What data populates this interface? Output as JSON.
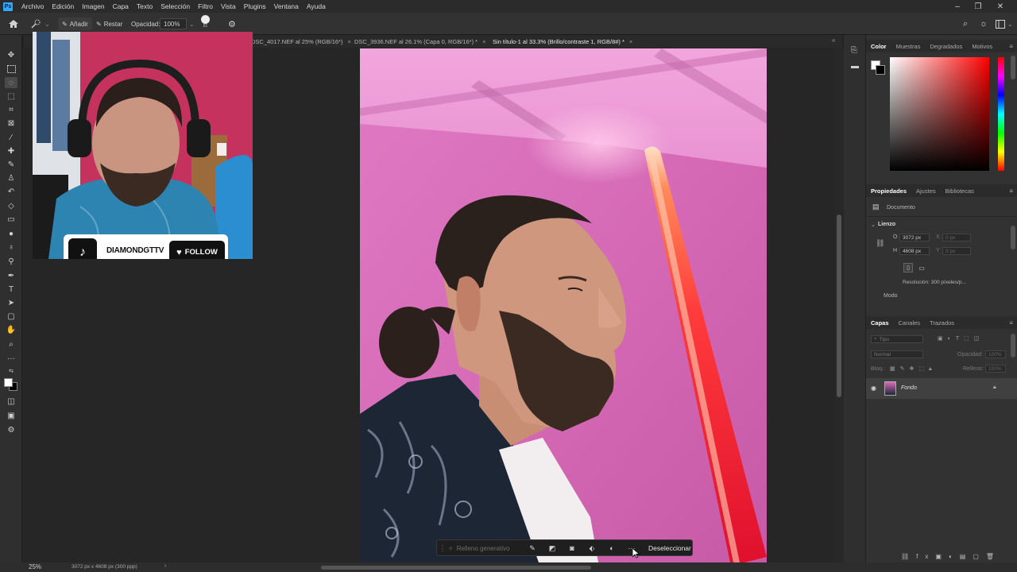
{
  "menubar": {
    "logo": "Ps",
    "items": [
      "Archivo",
      "Edición",
      "Imagen",
      "Capa",
      "Texto",
      "Selección",
      "Filtro",
      "Vista",
      "Plugins",
      "Ventana",
      "Ayuda"
    ]
  },
  "options": {
    "add_label": "Añadir",
    "subtract_label": "Restar",
    "opacity_label": "Opacidad:",
    "opacity_value": "100%",
    "brush_size": "81"
  },
  "tabs": [
    {
      "label": "DSC_4017.NEF al 25% (RGB/16*)"
    },
    {
      "label": "DSC_3936.NEF al 26.1% (Capa 0, RGB/16*) *"
    },
    {
      "label": "Sin título-1 al 33.3% (Brillo/contraste 1, RGB/8#) *"
    }
  ],
  "overlay": {
    "username": "DIAMONDGTTV",
    "follow_label": "FOLLOW"
  },
  "color_panel": {
    "tabs": [
      "Color",
      "Muestras",
      "Degradados",
      "Motivos"
    ]
  },
  "properties_panel": {
    "tabs": [
      "Propiedades",
      "Ajustes",
      "Bibliotecas"
    ],
    "doc_label": "Documento",
    "canvas_label": "Lienzo",
    "width_label": "O",
    "width_value": "3072 px",
    "height_label": "H",
    "height_value": "4608 px",
    "x_label": "X",
    "x_value": "0 px",
    "y_label": "Y",
    "y_value": "0 px",
    "resolution": "Resolución: 300 píxeles/p...",
    "mode_label": "Modo"
  },
  "layers_panel": {
    "tabs": [
      "Capas",
      "Canales",
      "Trazados"
    ],
    "search_placeholder": "Tipo",
    "blend_mode": "Normal",
    "opacity_label": "Opacidad:",
    "opacity_value": "100%",
    "lock_label": "Bloq.:",
    "fill_label": "Relleno:",
    "fill_value": "100%",
    "layers": [
      {
        "name": "Fondo"
      }
    ]
  },
  "statusbar": {
    "zoom": "25%",
    "doc_size": "3072 px x 4608 px (300 ppp)"
  },
  "taskbar": {
    "generative_fill": "Relleno generativo",
    "deselect": "Deseleccionar"
  },
  "colors": {
    "ps_blue": "#31a8ff",
    "backdrop_pink": "#d36fb6",
    "saber_red": "#ff3b2f"
  }
}
